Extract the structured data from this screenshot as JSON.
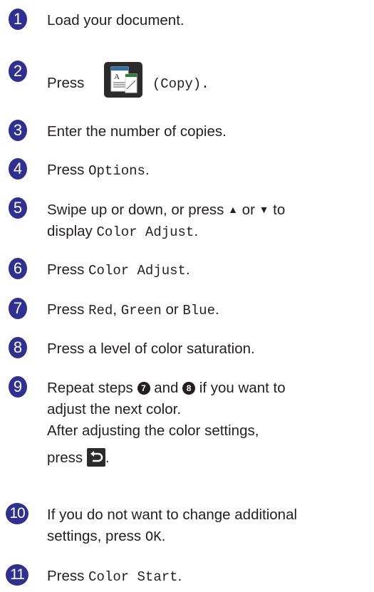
{
  "steps": [
    {
      "num": "1",
      "text": "Load your document."
    },
    {
      "num": "2",
      "pre": "Press",
      "post": "(Copy).",
      "icon": "copy-icon"
    },
    {
      "num": "3",
      "text": "Enter the number of copies."
    },
    {
      "num": "4",
      "pre": "Press ",
      "code": "Options",
      "post": "."
    },
    {
      "num": "5",
      "line1_pre": "Swipe up or down, or press ",
      "up": "▲",
      "or": " or ",
      "down": "▼",
      "line1_post": " to",
      "line2_pre": "display ",
      "code": "Color Adjust",
      "line2_post": "."
    },
    {
      "num": "6",
      "pre": "Press ",
      "code": "Color Adjust",
      "post": "."
    },
    {
      "num": "7",
      "pre": "Press ",
      "code1": "Red",
      "sep1": ", ",
      "code2": "Green",
      "sep2": " or ",
      "code3": "Blue",
      "post": "."
    },
    {
      "num": "8",
      "text": "Press a level of color saturation."
    },
    {
      "num": "9",
      "line1_pre": "Repeat steps ",
      "ref1": "7",
      "and": " and ",
      "ref2": "8",
      "line1_post": " if you want to",
      "line2": "adjust the next color.",
      "line3": "After adjusting the color settings,",
      "line4_pre": "press ",
      "line4_post": ".",
      "icon": "back-icon"
    },
    {
      "num": "10",
      "line1": "If you do not want to change additional",
      "line2_pre": "settings, press ",
      "code": "OK",
      "line2_post": "."
    },
    {
      "num": "11",
      "pre": "Press ",
      "code": "Color Start",
      "post": "."
    }
  ],
  "colors": {
    "badge": "#2e3192",
    "text": "#231f20",
    "icon_bg": "#2b2b2b",
    "icon_accent": "#2e7d32"
  }
}
